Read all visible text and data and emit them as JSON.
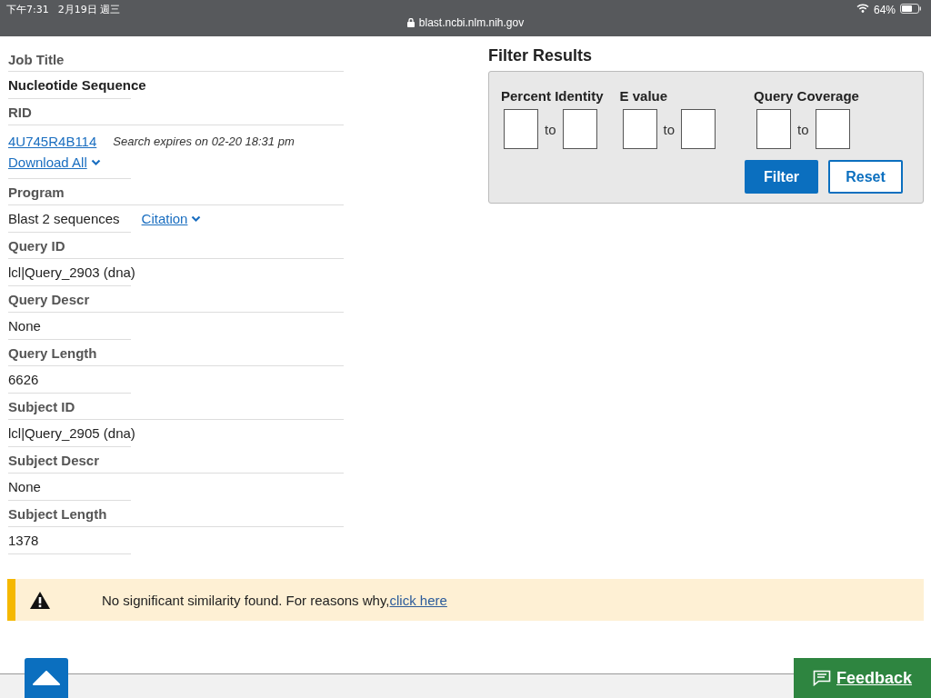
{
  "status_bar": {
    "time": "下午7:31",
    "date": "2月19日 週三",
    "url": "blast.ncbi.nlm.nih.gov",
    "battery": "64%"
  },
  "fields": [
    {
      "kind": "title",
      "label": "Job Title",
      "value": "Nucleotide Sequence"
    },
    {
      "kind": "rid",
      "label": "RID",
      "value": "4U745R4B114",
      "note": "Search expires on 02-20 18:31 pm",
      "link": "Download All"
    },
    {
      "kind": "program",
      "label": "Program",
      "value": "Blast 2 sequences",
      "link": "Citation"
    },
    {
      "kind": "plain",
      "label": "Query ID",
      "value": "lcl|Query_2903 (dna)"
    },
    {
      "kind": "plain",
      "label": "Query Descr",
      "value": "None"
    },
    {
      "kind": "plain",
      "label": "Query Length",
      "value": "6626"
    },
    {
      "kind": "plain",
      "label": "Subject ID",
      "value": "lcl|Query_2905 (dna)"
    },
    {
      "kind": "plain",
      "label": "Subject Descr",
      "value": "None"
    },
    {
      "kind": "plain",
      "label": "Subject Length",
      "value": "1378"
    }
  ],
  "filter": {
    "title": "Filter Results",
    "groups": [
      {
        "label": "Percent Identity",
        "separator": "to"
      },
      {
        "label": "E value",
        "separator": "to"
      },
      {
        "label": "Query Coverage",
        "separator": "to"
      }
    ],
    "buttons": [
      {
        "kind": "primary",
        "label": "Filter"
      },
      {
        "kind": "secondary",
        "label": "Reset"
      }
    ]
  },
  "alert": {
    "message": "No significant similarity found. For reasons why,",
    "link": "click here"
  },
  "feedback": "Feedback"
}
